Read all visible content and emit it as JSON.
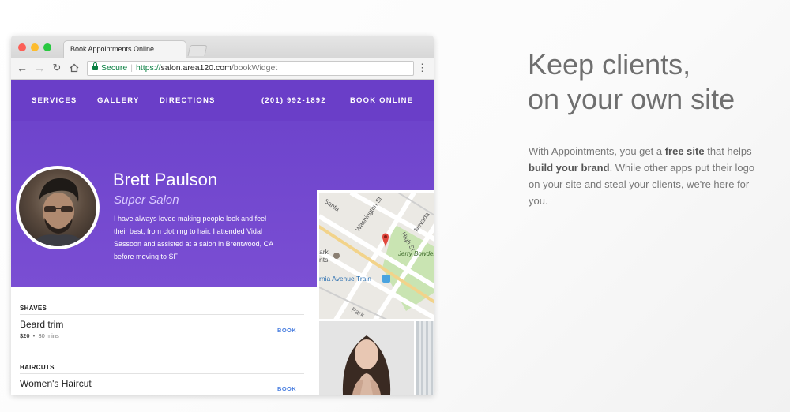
{
  "browser": {
    "tab_title": "Book Appointments Online",
    "secure_label": "Secure",
    "url_scheme": "https://",
    "url_host": "salon.area120.com",
    "url_path": "/bookWidget"
  },
  "site": {
    "nav": {
      "services": "SERVICES",
      "gallery": "GALLERY",
      "directions": "DIRECTIONS",
      "phone": "(201) 992-1892",
      "book_online": "BOOK ONLINE"
    },
    "stylist": {
      "name": "Brett Paulson",
      "salon": "Super Salon",
      "bio": "I have always loved making people look and feel their best, from clothing to hair. I attended Vidal Sassoon and assisted at a salon in Brentwood, CA before moving to SF"
    },
    "map": {
      "labels": [
        "Santa",
        "Washington St",
        "High St",
        "Nevada",
        "ark",
        "nts",
        "Jerry Bowden Park",
        "rnia Avenue Train",
        "Park"
      ]
    },
    "services": [
      {
        "category": "SHAVES",
        "items": [
          {
            "name": "Beard trim",
            "price": "$20",
            "duration": "30 mins",
            "action": "BOOK"
          }
        ]
      },
      {
        "category": "HAIRCUTS",
        "items": [
          {
            "name": "Women's Haircut",
            "action": "BOOK"
          }
        ]
      }
    ]
  },
  "marketing": {
    "headline_line1": "Keep clients,",
    "headline_line2": "on your own site",
    "body_prefix": "With Appointments, you get a ",
    "body_bold1": "free site",
    "body_mid1": " that helps ",
    "body_bold2": "build your brand",
    "body_suffix": ". While other apps put their logo on your site and steal your clients, we're here for you."
  },
  "colors": {
    "brand_purple": "#6a3ec8",
    "link_blue": "#4a7fe0",
    "secure_green": "#0b8043"
  }
}
